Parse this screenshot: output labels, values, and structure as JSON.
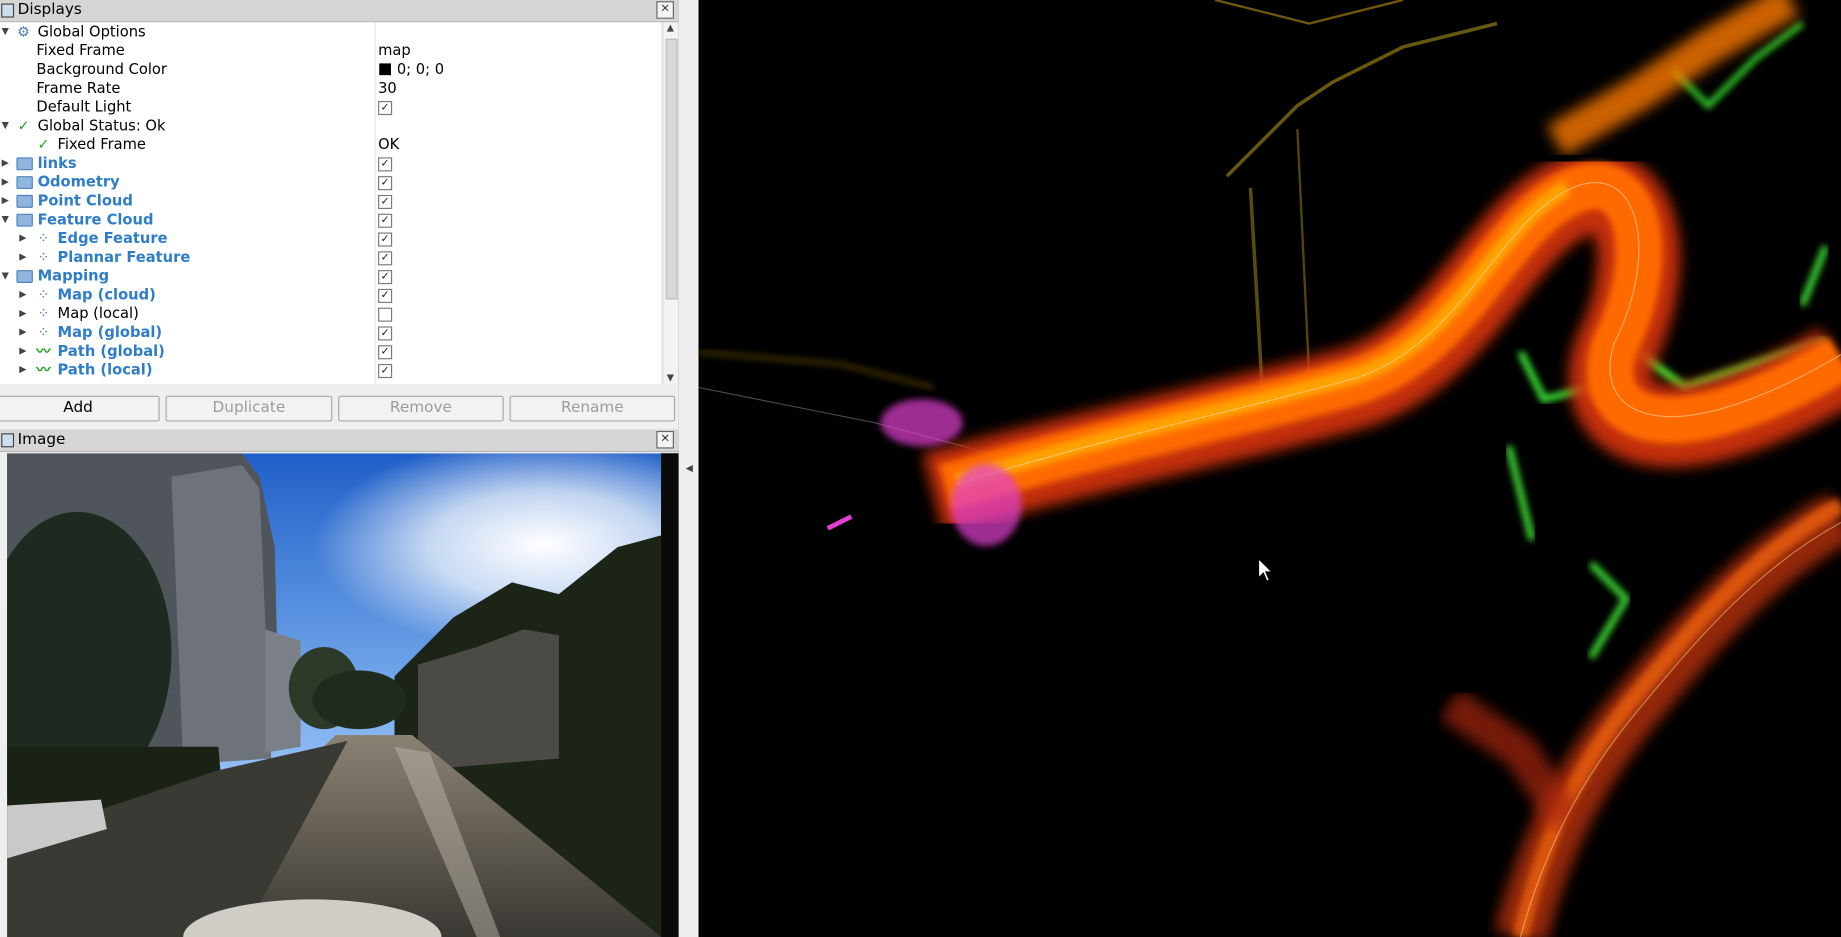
{
  "displays": {
    "title": "Displays",
    "rows": [
      {
        "label": "Global Options",
        "value": ""
      },
      {
        "label": "Fixed Frame",
        "value": "map"
      },
      {
        "label": "Background Color",
        "value": "0; 0; 0"
      },
      {
        "label": "Frame Rate",
        "value": "30"
      },
      {
        "label": "Default Light",
        "value": ""
      },
      {
        "label": "Global Status: Ok",
        "value": ""
      },
      {
        "label": "Fixed Frame",
        "value": "OK"
      },
      {
        "label": "links",
        "value": ""
      },
      {
        "label": "Odometry",
        "value": ""
      },
      {
        "label": "Point Cloud",
        "value": ""
      },
      {
        "label": "Feature Cloud",
        "value": ""
      },
      {
        "label": "Edge Feature",
        "value": ""
      },
      {
        "label": "Plannar Feature",
        "value": ""
      },
      {
        "label": "Mapping",
        "value": ""
      },
      {
        "label": "Map (cloud)",
        "value": ""
      },
      {
        "label": "Map (local)",
        "value": ""
      },
      {
        "label": "Map (global)",
        "value": ""
      },
      {
        "label": "Path (global)",
        "value": ""
      },
      {
        "label": "Path (local)",
        "value": ""
      }
    ],
    "checkbox_states": {
      "default_light": true,
      "links": true,
      "odometry": true,
      "point_cloud": true,
      "feature_cloud": true,
      "edge_feature": true,
      "plannar_feature": true,
      "mapping": true,
      "map_cloud": true,
      "map_local": false,
      "map_global": true,
      "path_global": true,
      "path_local": true
    },
    "background_color_swatch": "#000000",
    "enabled_label_color": "#2f7dc9",
    "status_ok_color": "#2aa02a"
  },
  "buttons": {
    "add": "Add",
    "duplicate": "Duplicate",
    "remove": "Remove",
    "rename": "Rename"
  },
  "image_panel": {
    "title": "Image"
  },
  "icons": {
    "close": "×",
    "expand": "▶",
    "collapse": "▼",
    "check": "✓",
    "gear": "⚙",
    "points": "⁘",
    "path": "〰"
  }
}
